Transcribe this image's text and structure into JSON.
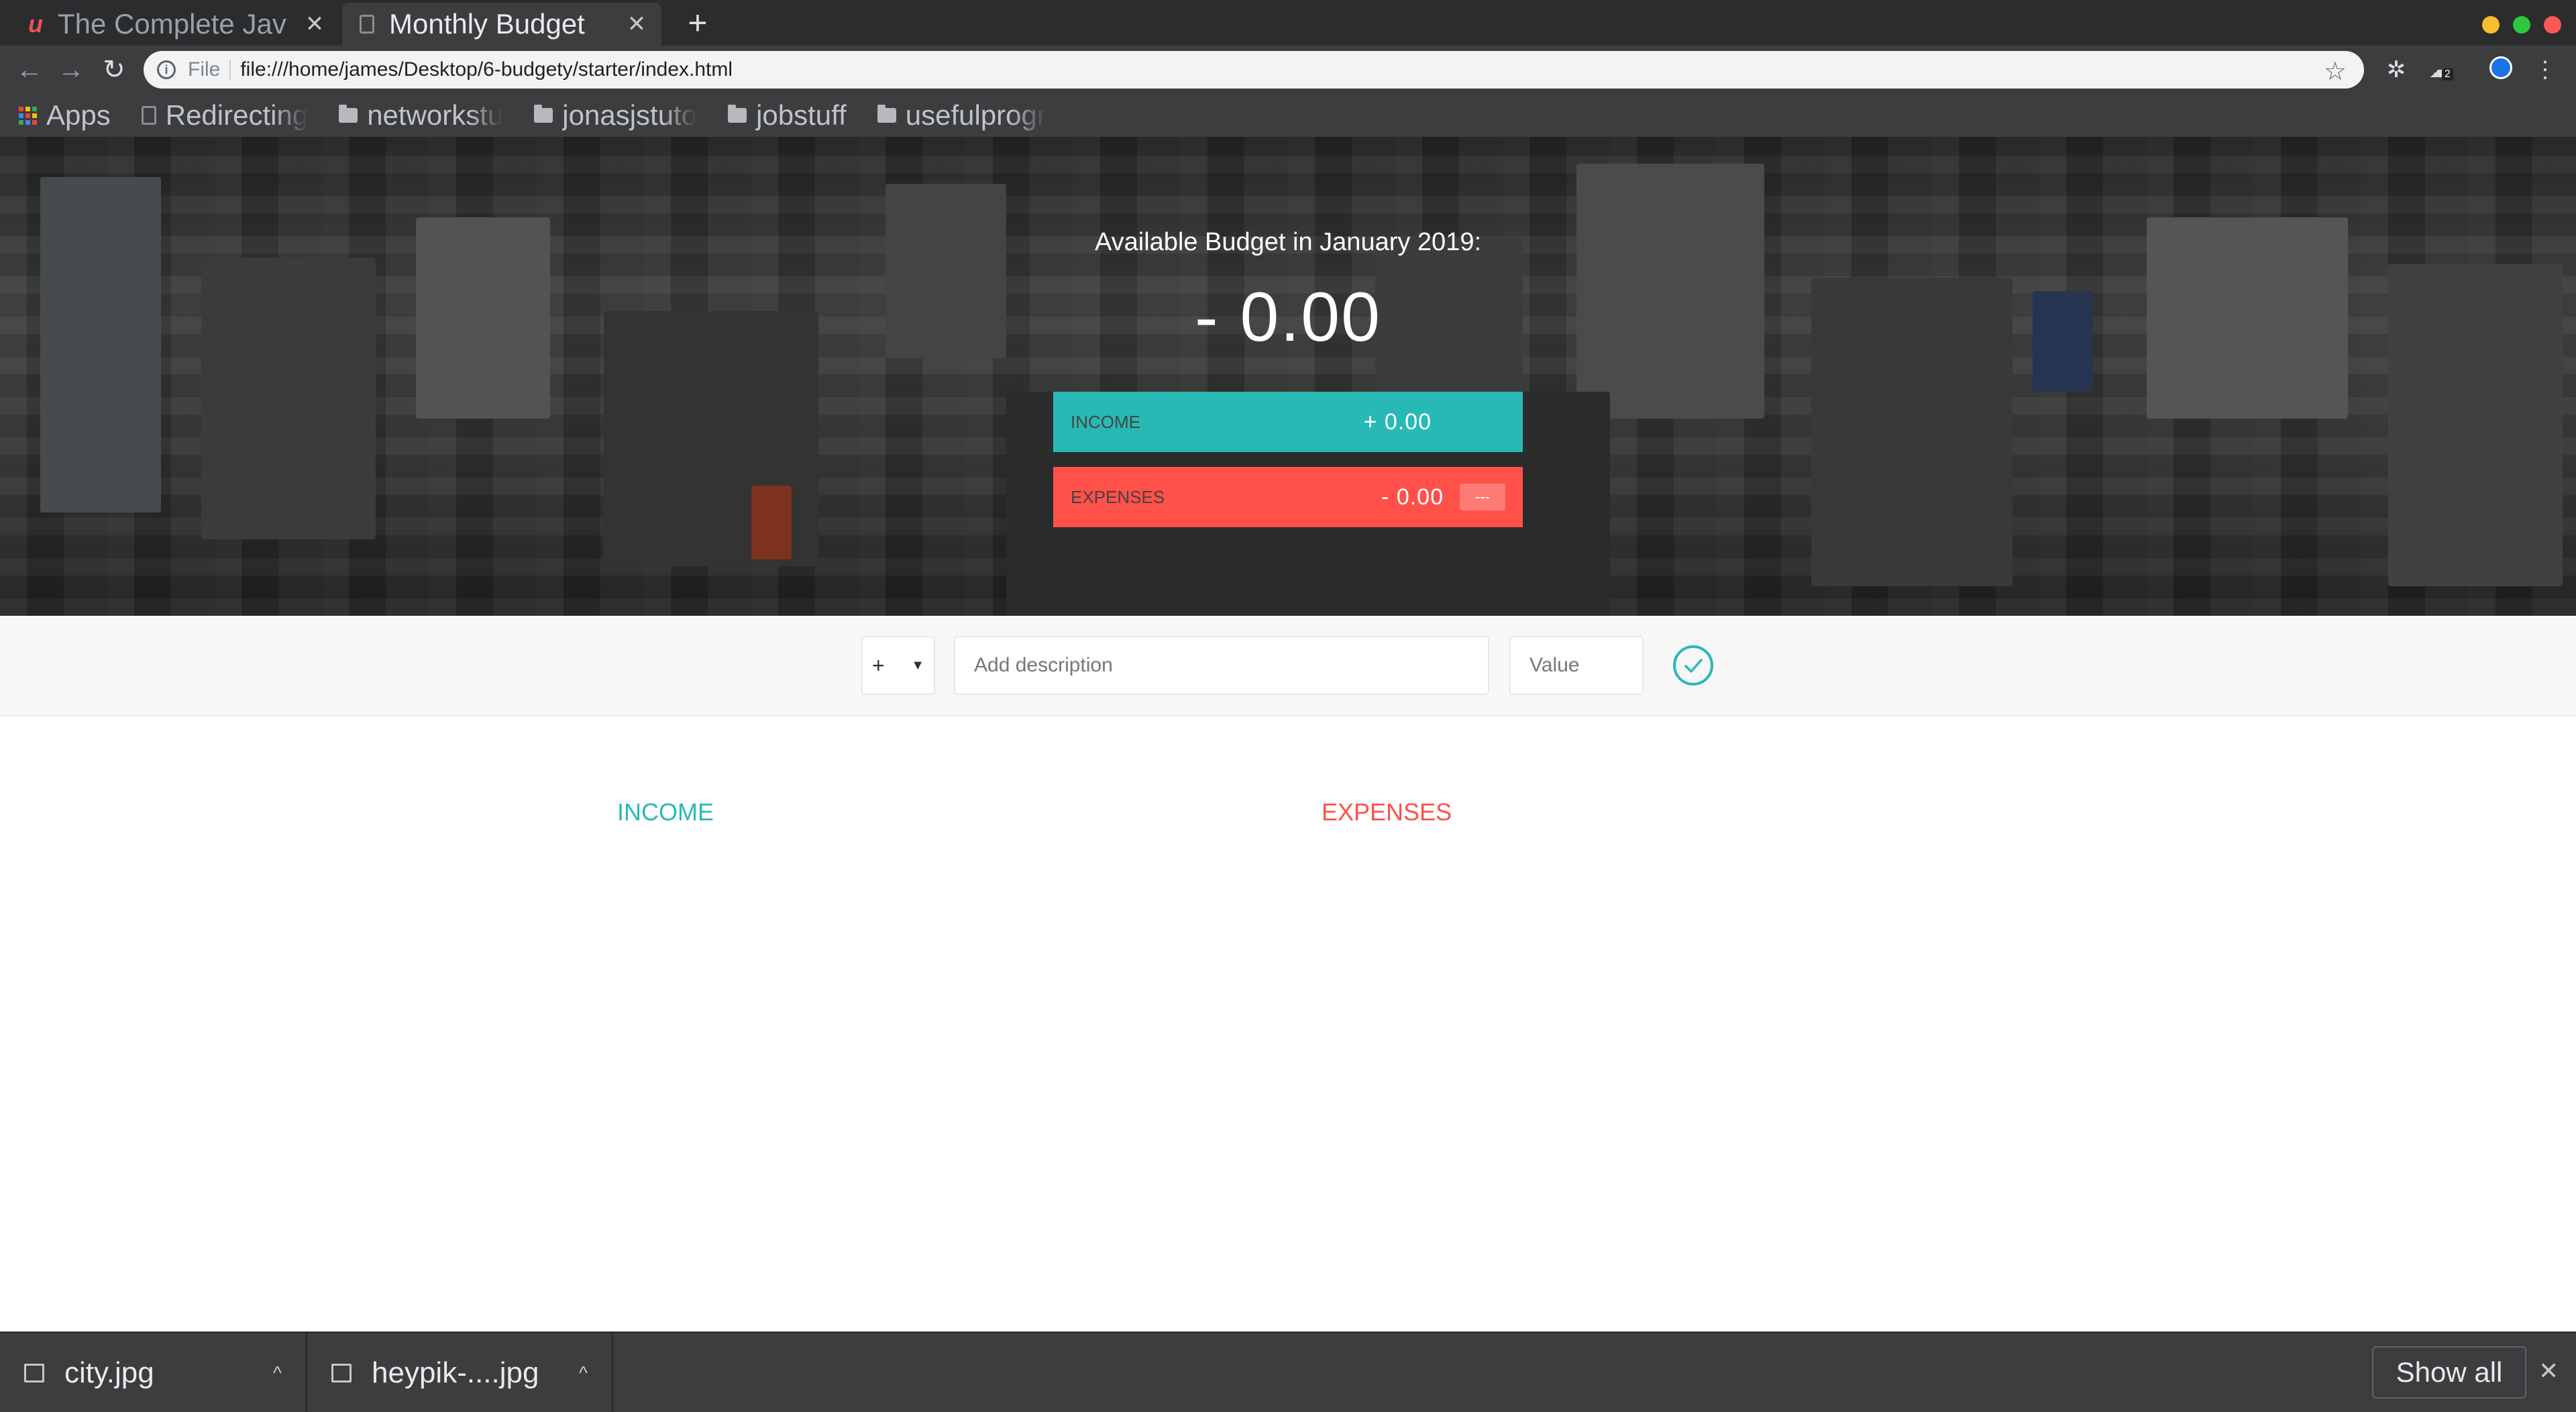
{
  "browser": {
    "tabs": [
      {
        "title": "The Complete Jav",
        "active": false
      },
      {
        "title": "Monthly Budget",
        "active": true
      }
    ],
    "new_tab_label": "+",
    "url_scheme": "File",
    "url": "file:///home/james/Desktop/6-budgety/starter/index.html",
    "extension_badge": "2",
    "window_controls": {
      "minimize_color": "#f5bf2d",
      "maximize_color": "#2ac940",
      "close_color": "#fc5753"
    },
    "bookmarks": [
      {
        "label": "Apps",
        "icon": "apps-grid-icon"
      },
      {
        "label": "Redirecting",
        "icon": "page-icon"
      },
      {
        "label": "networkstu",
        "icon": "folder-icon"
      },
      {
        "label": "jonasjstuto",
        "icon": "folder-icon"
      },
      {
        "label": "jobstuff",
        "icon": "folder-icon"
      },
      {
        "label": "usefulprogr",
        "icon": "folder-icon"
      }
    ]
  },
  "budget": {
    "title": "Available Budget in January 2019:",
    "value": "- 0.00",
    "income": {
      "label": "Income",
      "value": "+ 0.00"
    },
    "expenses": {
      "label": "Expenses",
      "value": "- 0.00",
      "percentage": "---"
    }
  },
  "add_form": {
    "type_selected": "+",
    "type_arrow": "▼",
    "description_placeholder": "Add description",
    "value_placeholder": "Value"
  },
  "lists": {
    "income_title": "Income",
    "expenses_title": "Expenses"
  },
  "downloads": {
    "items": [
      {
        "name": "city.jpg"
      },
      {
        "name": "heypik-....jpg"
      }
    ],
    "show_all_label": "Show all",
    "close_label": "✕"
  },
  "colors": {
    "income_accent": "#28b9b5",
    "expense_accent": "#ff5049",
    "browser_dark": "#3c3d3f"
  }
}
